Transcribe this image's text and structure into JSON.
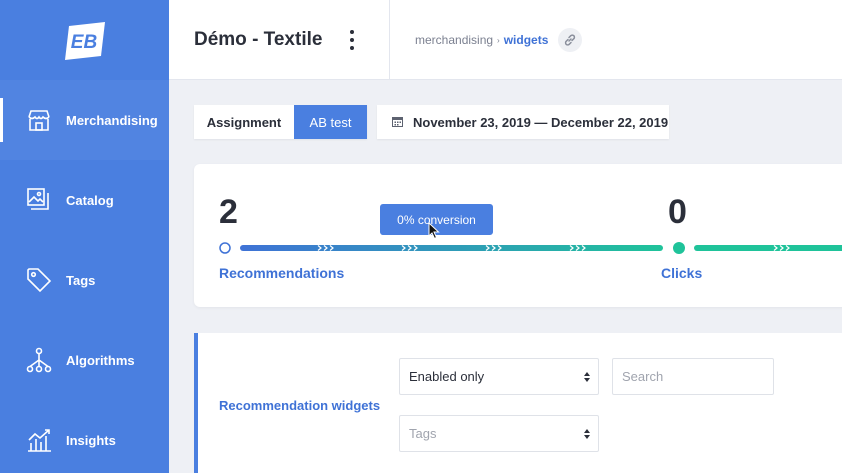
{
  "app": {
    "title": "Démo - Textile",
    "logo_text": "EB"
  },
  "sidebar": {
    "items": [
      {
        "label": "Merchandising",
        "icon": "storefront-icon",
        "active": true
      },
      {
        "label": "Catalog",
        "icon": "images-icon",
        "active": false
      },
      {
        "label": "Tags",
        "icon": "tag-icon",
        "active": false
      },
      {
        "label": "Algorithms",
        "icon": "hierarchy-icon",
        "active": false
      },
      {
        "label": "Insights",
        "icon": "chart-icon",
        "active": false
      }
    ]
  },
  "breadcrumb": {
    "parent": "merchandising",
    "separator": "›",
    "current": "widgets"
  },
  "toolbar": {
    "tabs": [
      {
        "label": "Assignment",
        "active": false
      },
      {
        "label": "AB test",
        "active": true
      }
    ],
    "date_range": "November 23, 2019 — December 22, 2019"
  },
  "funnel": {
    "steps": [
      {
        "value": "2",
        "label": "Recommendations"
      },
      {
        "value": "0",
        "label": "Clicks"
      }
    ],
    "conversion": "0% conversion"
  },
  "widgets_section": {
    "label": "Recommendation widgets",
    "status_select": "Enabled only",
    "search_placeholder": "Search",
    "tags_placeholder": "Tags"
  },
  "colors": {
    "sidebar": "#4a7fe0",
    "accent_blue": "#3f72d6",
    "accent_teal": "#1fc39a"
  }
}
